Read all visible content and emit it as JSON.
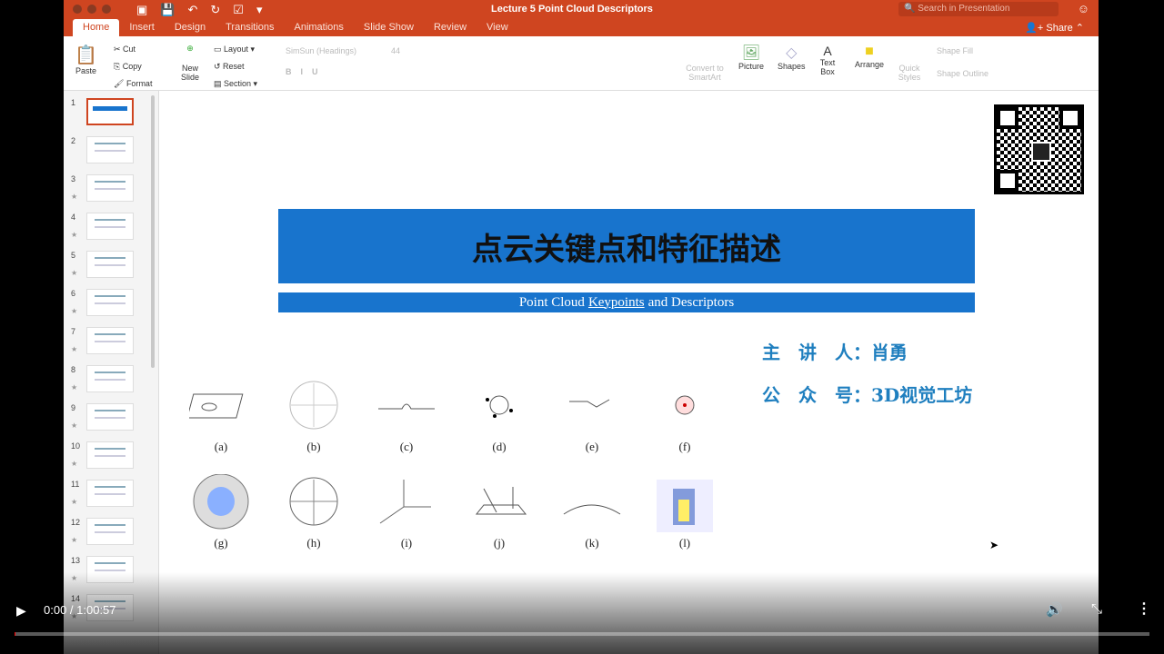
{
  "window": {
    "title": "Lecture 5 Point Cloud Descriptors",
    "search_placeholder": "Search in Presentation"
  },
  "tabs": [
    "Home",
    "Insert",
    "Design",
    "Transitions",
    "Animations",
    "Slide Show",
    "Review",
    "View"
  ],
  "share": "Share",
  "ribbon": {
    "paste": "Paste",
    "cut": "Cut",
    "copy": "Copy",
    "format": "Format",
    "new_slide": "New Slide",
    "layout": "Layout",
    "reset": "Reset",
    "section": "Section",
    "font": "SimSun (Headings)",
    "size": "44",
    "convert": "Convert to SmartArt",
    "picture": "Picture",
    "shapes": "Shapes",
    "textbox": "Text Box",
    "arrange": "Arrange",
    "quick_styles": "Quick Styles",
    "shape_fill": "Shape Fill",
    "shape_outline": "Shape Outline"
  },
  "thumbnails": [
    "1",
    "2",
    "3",
    "4",
    "5",
    "6",
    "7",
    "8",
    "9",
    "10",
    "11",
    "12",
    "13",
    "14"
  ],
  "slide": {
    "title": "点云关键点和特征描述",
    "subtitle_pre": "Point Cloud",
    "subtitle_link": "Keypoints",
    "subtitle_post": "and Descriptors",
    "presenter": "主　讲　人：肖勇",
    "account": "公　众　号：3D视觉工坊",
    "figures": [
      "(a)",
      "(b)",
      "(c)",
      "(d)",
      "(e)",
      "(f)",
      "(g)",
      "(h)",
      "(i)",
      "(j)",
      "(k)",
      "(l)"
    ]
  },
  "player": {
    "time": "0:00 / 1:00:57",
    "progress": 0.001
  }
}
